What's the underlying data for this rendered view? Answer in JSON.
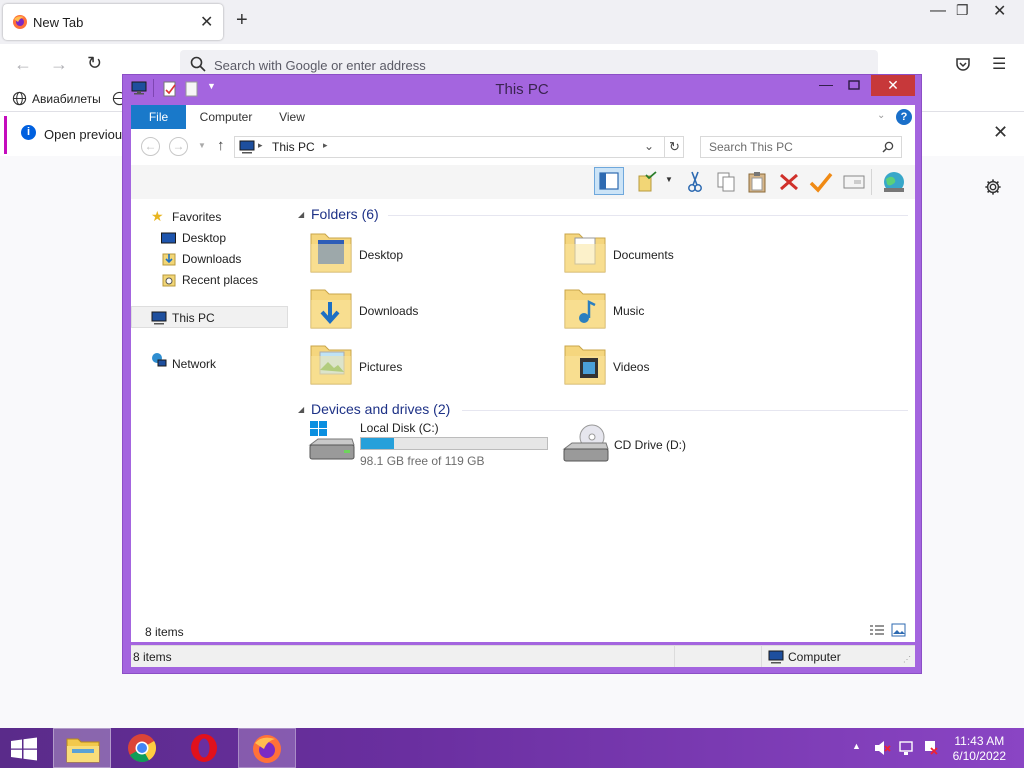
{
  "browser": {
    "tab_title": "New Tab",
    "url_placeholder": "Search with Google or enter address",
    "bookmark": "Авиабилеты",
    "notice_text": "Open previous"
  },
  "explorer": {
    "title": "This PC",
    "ribbon_tabs": [
      "File",
      "Computer",
      "View"
    ],
    "address": "This PC",
    "search_placeholder": "Search This PC",
    "nav": {
      "favorites": "Favorites",
      "desktop": "Desktop",
      "downloads": "Downloads",
      "recent": "Recent places",
      "this_pc": "This PC",
      "network": "Network"
    },
    "folders_header": "Folders (6)",
    "folders": [
      "Desktop",
      "Documents",
      "Downloads",
      "Music",
      "Pictures",
      "Videos"
    ],
    "devices_header": "Devices and drives (2)",
    "drive_c": {
      "name": "Local Disk (C:)",
      "free": "98.1 GB free of 119 GB",
      "used_fraction": 0.176
    },
    "drive_d": {
      "name": "CD Drive (D:)"
    },
    "items_count": "8 items",
    "status_items": "8 items",
    "status_location": "Computer"
  },
  "taskbar": {
    "time": "11:43 AM",
    "date": "6/10/2022"
  },
  "colors": {
    "window_frame": "#a465df",
    "file_tab": "#1979ca",
    "close_button": "#c7383a",
    "drive_bar": "#26a0da"
  }
}
